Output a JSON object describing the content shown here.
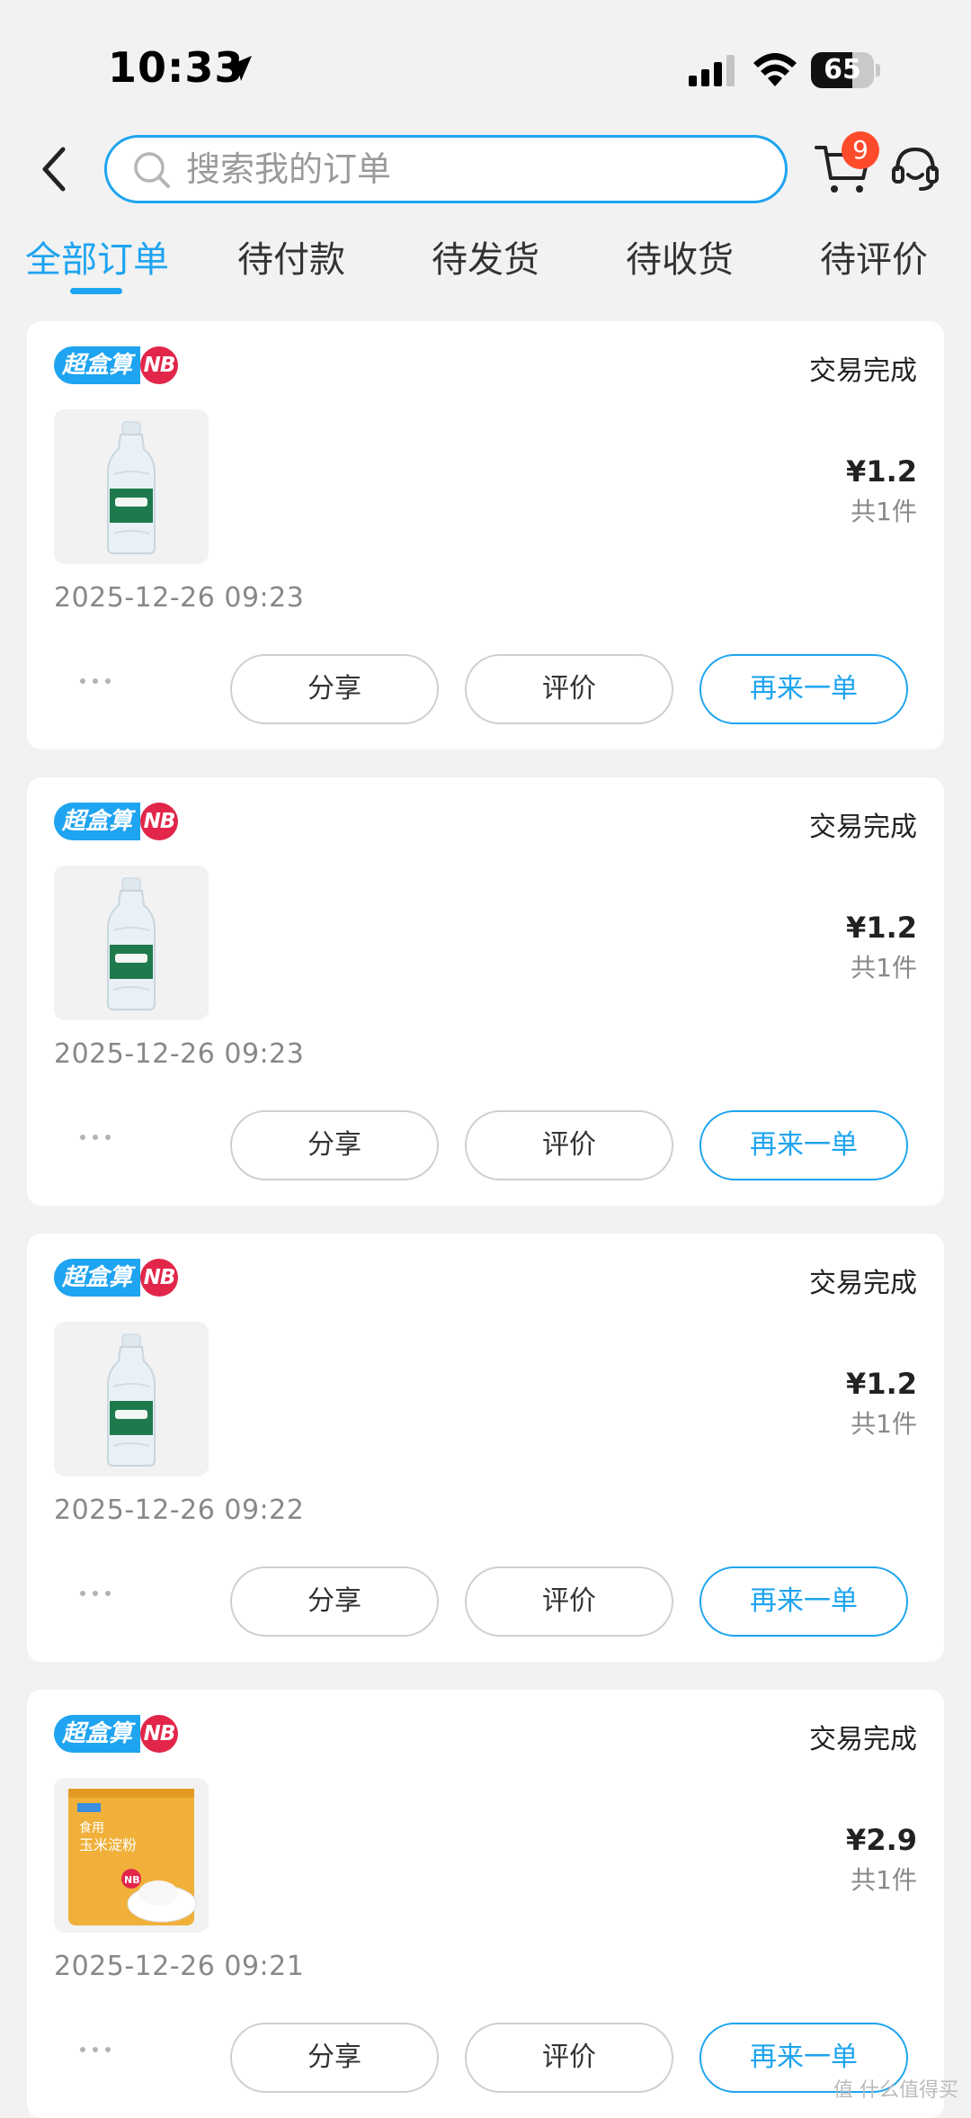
{
  "status_bar": {
    "time": "10:33",
    "battery": "65",
    "battery_level": 0.65
  },
  "header": {
    "search_placeholder": "搜索我的订单",
    "cart_badge": "9"
  },
  "tabs": [
    {
      "label": "全部订单",
      "active": true
    },
    {
      "label": "待付款",
      "active": false
    },
    {
      "label": "待发货",
      "active": false
    },
    {
      "label": "待收货",
      "active": false
    },
    {
      "label": "待评价",
      "active": false
    }
  ],
  "orders": [
    {
      "store": "超盒算",
      "store_sub": "NB",
      "status": "交易完成",
      "price": "¥1.2",
      "quantity": "共1件",
      "time": "2025-12-26 09:23",
      "product_image": "water-bottle-image"
    },
    {
      "store": "超盒算",
      "store_sub": "NB",
      "status": "交易完成",
      "price": "¥1.2",
      "quantity": "共1件",
      "time": "2025-12-26 09:23",
      "product_image": "water-bottle-image"
    },
    {
      "store": "超盒算",
      "store_sub": "NB",
      "status": "交易完成",
      "price": "¥1.2",
      "quantity": "共1件",
      "time": "2025-12-26 09:22",
      "product_image": "water-bottle-image"
    },
    {
      "store": "超盒算",
      "store_sub": "NB",
      "status": "交易完成",
      "price": "¥2.9",
      "quantity": "共1件",
      "time": "2025-12-26 09:21",
      "product_image": "corn-starch-bag-image"
    }
  ],
  "actions": {
    "share": "分享",
    "review": "评价",
    "reorder": "再来一单"
  },
  "colors": {
    "accent": "#1ea4f0",
    "badge_red": "#ff4b2b",
    "brand_red": "#e2264a",
    "background": "#f2f2f2"
  },
  "watermark": "值 什么值得买"
}
